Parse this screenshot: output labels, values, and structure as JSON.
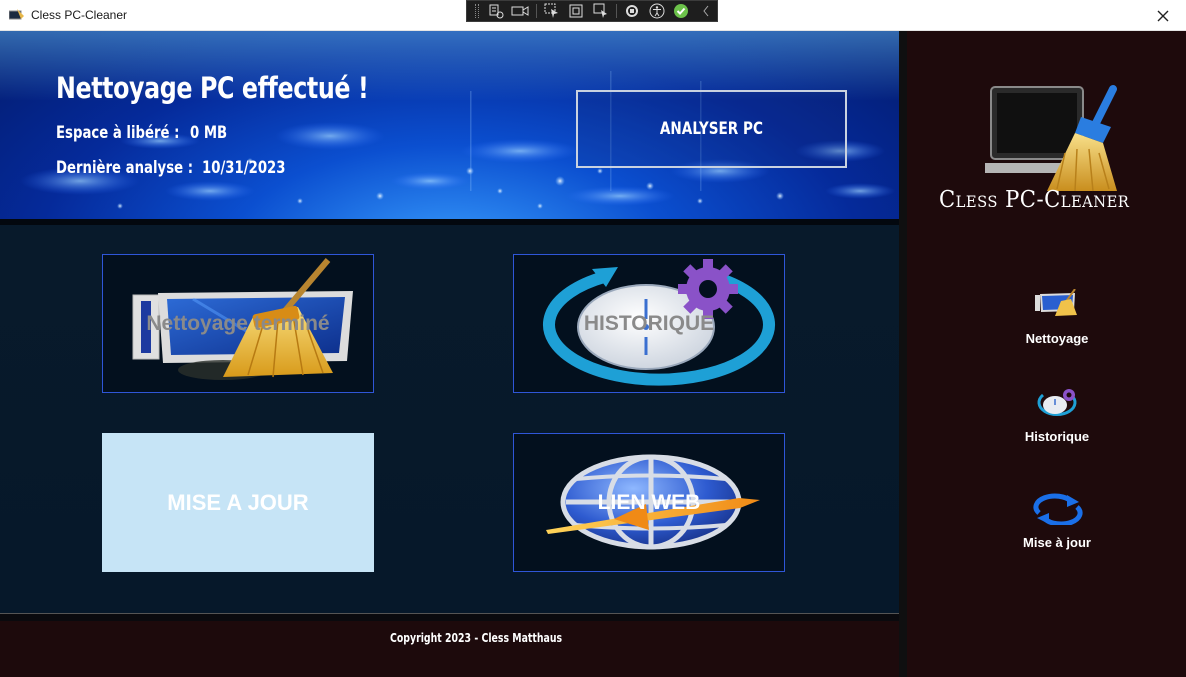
{
  "window": {
    "title": "Cless PC-Cleaner"
  },
  "banner": {
    "heading": "Nettoyage PC effectué !",
    "space_label": "Espace à libéré :",
    "space_value": "0 MB",
    "last_scan_label": "Dernière analyse :",
    "last_scan_value": "10/31/2023",
    "analyze_button": "ANALYSER PC"
  },
  "tiles": {
    "cleanup": "Nettoyage terminé",
    "history": "HISTORIQUE",
    "update": "MISE A JOUR",
    "web": "LIEN WEB"
  },
  "footer": {
    "copyright": "Copyright 2023 - Cless Matthaus"
  },
  "sidebar": {
    "brand": "Cless PC-Cleaner",
    "items": [
      {
        "label": "Nettoyage",
        "icon": "broom-computer-icon"
      },
      {
        "label": "Historique",
        "icon": "clock-gear-icon"
      },
      {
        "label": "Mise à jour",
        "icon": "refresh-arrows-icon"
      }
    ]
  },
  "colors": {
    "sidebar_bg": "#1e0a0c",
    "content_bg": "#07121f",
    "tile_border": "#2f56d8",
    "update_tile_bg": "#c6e4f6",
    "banner_blue": "#0b4fd0"
  }
}
